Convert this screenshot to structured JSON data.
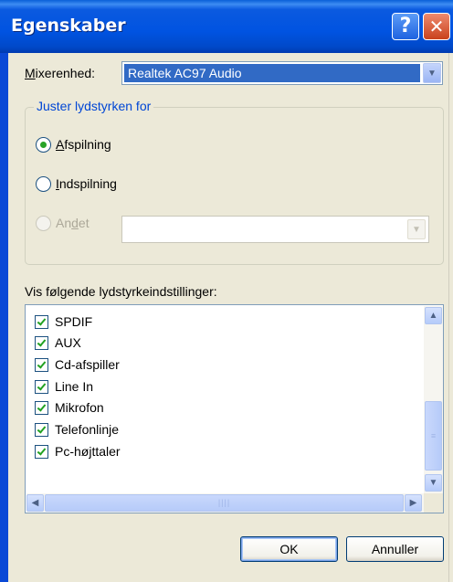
{
  "window": {
    "title": "Egenskaber",
    "help_glyph": "?",
    "close_glyph": "✕"
  },
  "mixer": {
    "label_first": "M",
    "label_rest": "ixerenhed:",
    "value": "Realtek AC97 Audio",
    "dropdown_glyph": "▼"
  },
  "volume_group": {
    "legend": "Juster lydstyrken for",
    "options": [
      {
        "first": "A",
        "rest": "fspilning",
        "selected": true,
        "enabled": true
      },
      {
        "first": "I",
        "rest": "ndspilning",
        "selected": false,
        "enabled": true
      },
      {
        "pre": "An",
        "first": "d",
        "rest": "et",
        "selected": false,
        "enabled": false
      }
    ],
    "other_value": ""
  },
  "controls": {
    "caption": "Vis følgende lydstyrkeindstillinger:",
    "items": [
      {
        "label": "SPDIF",
        "checked": true
      },
      {
        "label": "AUX",
        "checked": true
      },
      {
        "label": "Cd-afspiller",
        "checked": true
      },
      {
        "label": "Line In",
        "checked": true
      },
      {
        "label": "Mikrofon",
        "checked": true
      },
      {
        "label": "Telefonlinje",
        "checked": true
      },
      {
        "label": "Pc-højttaler",
        "checked": true
      }
    ]
  },
  "scroll": {
    "up": "▲",
    "down": "▼",
    "left": "◀",
    "right": "▶",
    "grip_v": "≡",
    "grip_h": "||||"
  },
  "buttons": {
    "ok": "OK",
    "cancel": "Annuller"
  }
}
